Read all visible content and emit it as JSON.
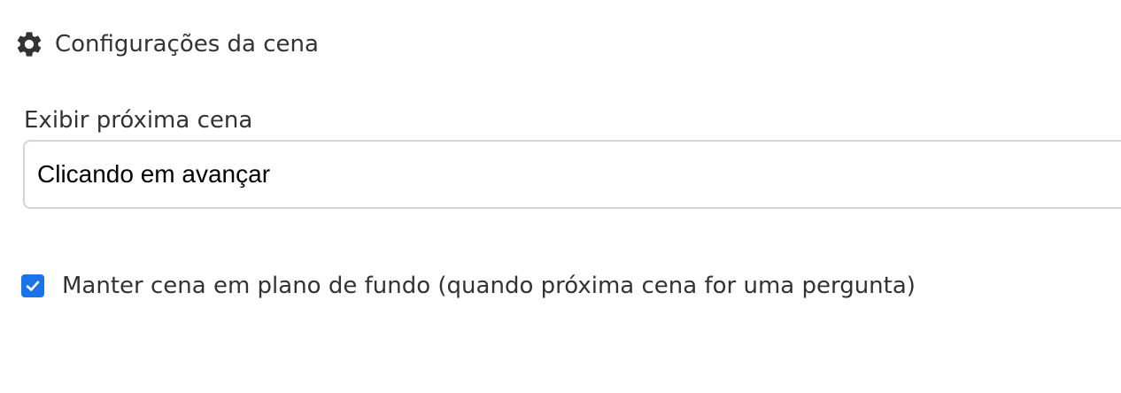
{
  "header": {
    "icon": "gear-icon",
    "title": "Configurações da cena"
  },
  "next_scene": {
    "label": "Exibir próxima cena",
    "selected_value": "Clicando em avançar"
  },
  "keep_background": {
    "checked": true,
    "label": "Manter cena em plano de fundo (quando próxima cena for uma pergunta)"
  },
  "colors": {
    "accent": "#1a73e8",
    "text": "#333333",
    "border": "#d4d4d4"
  }
}
